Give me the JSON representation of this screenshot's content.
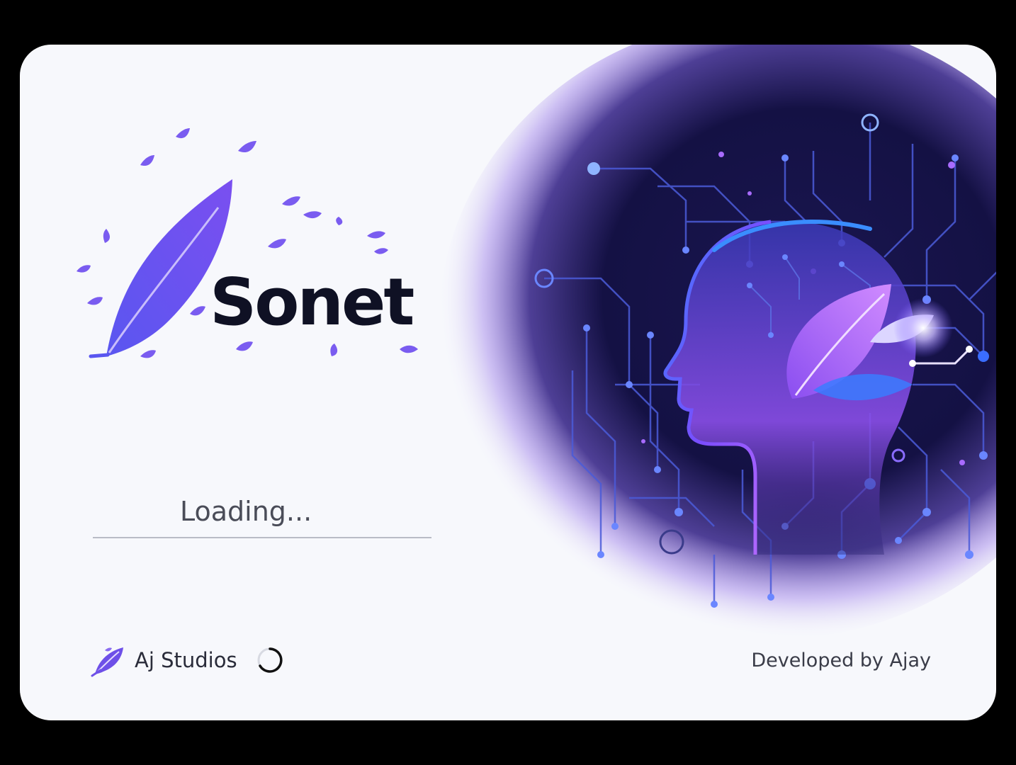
{
  "app": {
    "title": "Sonet"
  },
  "splash": {
    "loading_text": "Loading...",
    "studio_name": "Aj Studios",
    "developer_credit": "Developed by Ajay"
  },
  "icons": {
    "brand_logo": "feather-leaf-icon",
    "studio_logo": "leaf-icon",
    "spinner": "spinner-icon",
    "hero_art": "ai-head-circuit-illustration"
  },
  "colors": {
    "brand_purple": "#6e50e8",
    "title": "#0f1124",
    "art_dark": "#12103a",
    "art_glow": "#8a5cff"
  }
}
